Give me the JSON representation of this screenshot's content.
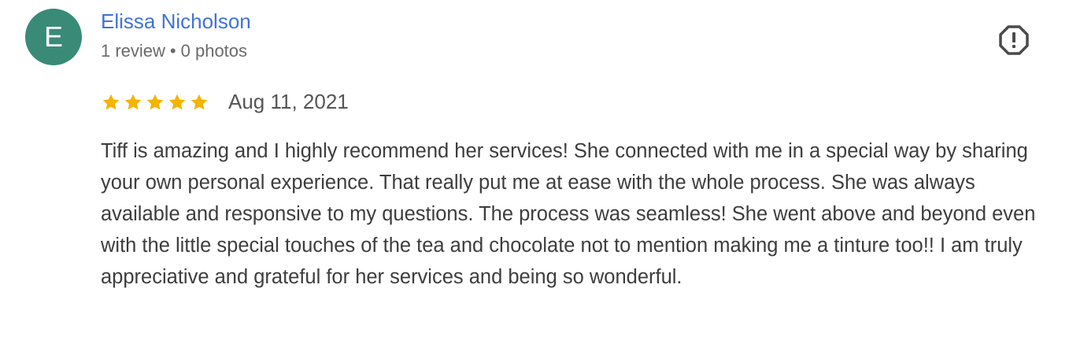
{
  "reviewer": {
    "initial": "E",
    "avatar_color": "#3a8a78",
    "name": "Elissa Nicholson",
    "name_color": "#3f73d6",
    "review_count": "1 review",
    "separator": "•",
    "photo_count": "0 photos"
  },
  "report_icon": "exclamation-octagon-icon",
  "review": {
    "rating": 5,
    "max_rating": 5,
    "star_color": "#f4b400",
    "date": "Aug 11, 2021",
    "text": "Tiff is amazing and I highly recommend her services! She connected with me in a special way by sharing your own personal experience. That really put me at ease with the whole process. She was always available and responsive to my questions. The process was seamless! She went above and beyond even with the little special touches of the tea and chocolate not to mention making me a tinture too!! I am truly appreciative and grateful for her services and being so wonderful."
  }
}
